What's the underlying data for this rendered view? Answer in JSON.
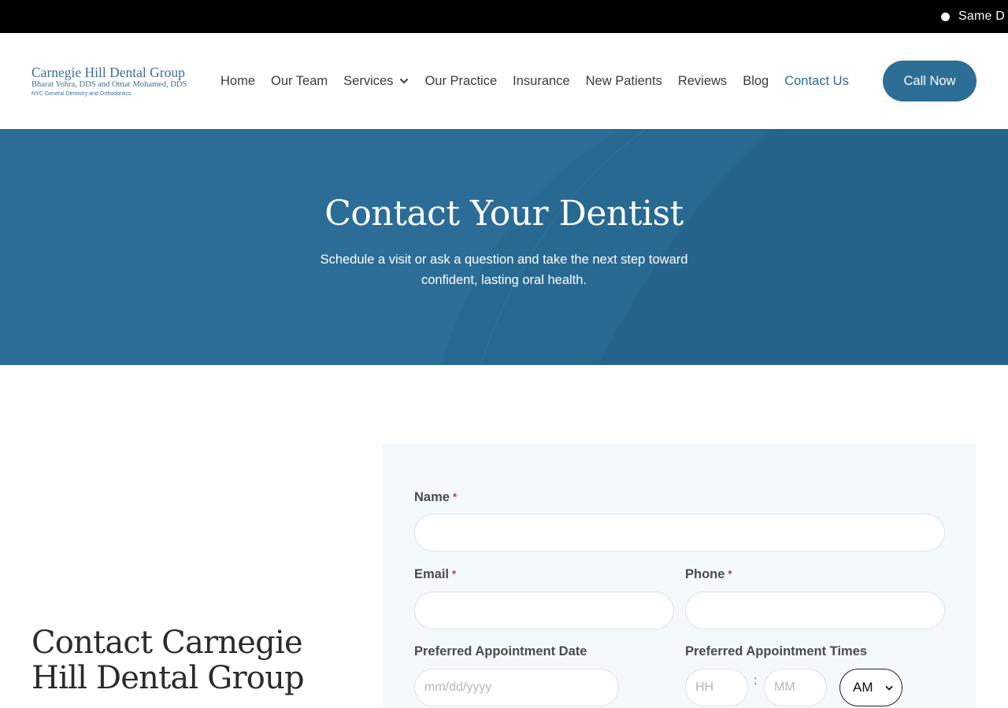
{
  "topbar": {
    "ticker_text": "Same D"
  },
  "logo": {
    "line1": "Carnegie Hill Dental Group",
    "line2": "Bharat Vohra, DDS and Omar Mohamed, DDS",
    "line3": "NYC General Dentistry and Orthodontics"
  },
  "nav": {
    "items": [
      {
        "label": "Home"
      },
      {
        "label": "Our Team"
      },
      {
        "label": "Services"
      },
      {
        "label": "Our Practice"
      },
      {
        "label": "Insurance"
      },
      {
        "label": "New Patients"
      },
      {
        "label": "Reviews"
      },
      {
        "label": "Blog"
      },
      {
        "label": "Contact Us"
      }
    ],
    "call_button": "Call Now"
  },
  "hero": {
    "title": "Contact Your Dentist",
    "subtitle": "Schedule a visit or ask a question and take the next step toward confident, lasting oral health."
  },
  "section": {
    "heading": "Contact Carnegie Hill Dental Group"
  },
  "form": {
    "name_label": "Name",
    "email_label": "Email",
    "phone_label": "Phone",
    "required_mark": "*",
    "date_label": "Preferred Appointment Date",
    "times_label": "Preferred Appointment Times",
    "date_placeholder": "mm/dd/yyyy",
    "hour_placeholder": "HH",
    "minute_placeholder": "MM",
    "time_separator": ":",
    "ampm_value": "AM"
  },
  "colors": {
    "brand_blue": "#2d6e96",
    "hero_bg": "#2b6d96",
    "form_bg": "#f4f9fc",
    "required": "#c0392b",
    "topbar_bg": "#000000"
  },
  "icons": {
    "services_dropdown": "chevron-down-icon",
    "ampm_select": "chevron-down-icon",
    "ticker_bullet": "bullet-dot-icon"
  }
}
